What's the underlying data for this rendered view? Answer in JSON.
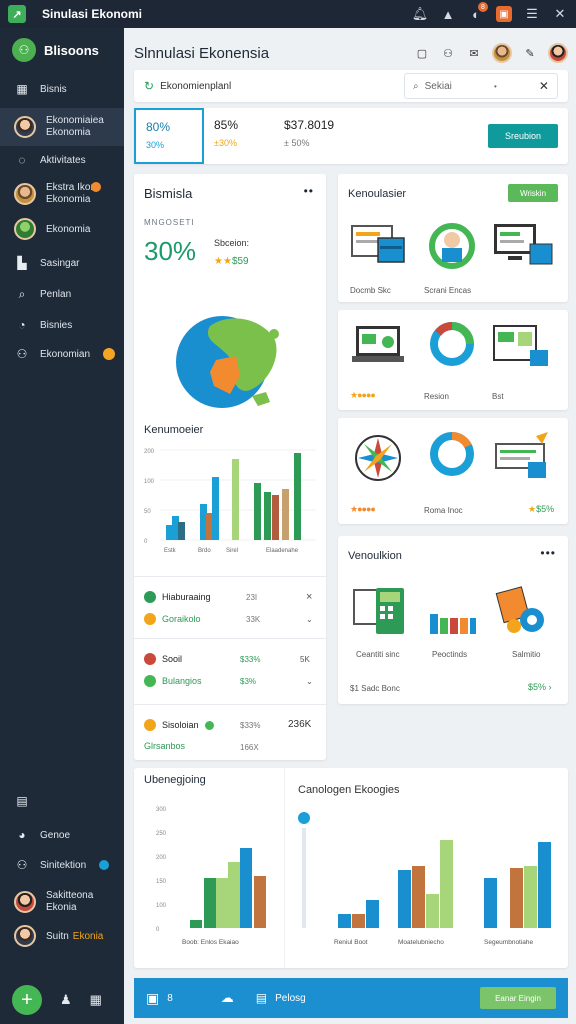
{
  "titlebar": {
    "title": "Sinulasi Ekonomi",
    "logo_glyph": "↗",
    "notif_badge": "8"
  },
  "sidebar": {
    "brand": "Blisoons",
    "items": [
      {
        "label": "Bisnis",
        "icon": "grid-icon"
      },
      {
        "label": "Ekonomiaiea",
        "label2": "Ekonomia",
        "icon": "avatar"
      },
      {
        "label": "Aktivitates",
        "icon": "activity-icon"
      },
      {
        "label": "Ekstra Ikon",
        "label2": "Ekonomia",
        "icon": "avatar"
      },
      {
        "label": "Ekonomia",
        "icon": "avatar"
      },
      {
        "label": "Sasingar",
        "icon": "folder-icon"
      },
      {
        "label": "Penlan",
        "icon": "search-icon"
      },
      {
        "label": "Bisnies",
        "icon": "gauge-icon"
      },
      {
        "label": "Ekonomian",
        "icon": "users-icon"
      }
    ],
    "lower": [
      {
        "label": "Genoe",
        "icon": "person-icon"
      },
      {
        "label": "Sinitektion",
        "icon": "people-icon"
      },
      {
        "label": "Sakitteona",
        "label2": "Ekonia",
        "icon": "avatar"
      },
      {
        "label": "Suitn",
        "label2": "Ekonia",
        "icon": "avatar"
      }
    ]
  },
  "header": {
    "title": "Slnnulasi Ekonensia"
  },
  "search": {
    "label": "Ekonomienplanl",
    "placeholder": "Sekiai"
  },
  "stats": [
    {
      "v1": "80%",
      "v2": "30%",
      "color": "#1a9fd6"
    },
    {
      "v1": "85%",
      "v2": "±30%",
      "color": "#f2a51a"
    },
    {
      "v1": "$37.8019",
      "v2": "± 50%",
      "color": "#777777"
    }
  ],
  "stats_button": "Sreubion",
  "bisnis": {
    "title": "Bismisla",
    "subtitle": "MNGOSETI",
    "big": "30%",
    "mini1": "Sbceion:",
    "mini2_stars": "★★",
    "mini2_value": "$59",
    "chart_title": "Kenumoeier",
    "chart_ylabels": [
      "200",
      "100",
      "50",
      "0"
    ],
    "chart_xlabels": [
      "Estk",
      "Brdo",
      "Sirel",
      "Elaadenahe"
    ],
    "chart_bars": [
      {
        "v": 10,
        "c": "#1a9fd6"
      },
      {
        "v": 16,
        "c": "#1a9fd6"
      },
      {
        "v": 12,
        "c": "#2d6e86"
      },
      {
        "v": 24,
        "c": "#1a9fd6"
      },
      {
        "v": 18,
        "c": "#c1743e"
      },
      {
        "v": 42,
        "c": "#1a9fd6"
      },
      {
        "v": 54,
        "c": "#a6d57a"
      },
      {
        "v": 38,
        "c": "#2d9a55"
      },
      {
        "v": 32,
        "c": "#2d9a55"
      },
      {
        "v": 30,
        "c": "#b25d3f"
      },
      {
        "v": 34,
        "c": "#c7a16d"
      },
      {
        "v": 58,
        "c": "#2d9a55"
      }
    ],
    "rows": [
      {
        "r1": "Hiaburaaing",
        "r2": "Goraikolo",
        "v1": "23I",
        "v2": "33K",
        "close": "×",
        "dot1": "#2d9a55",
        "dot2": "#f2a51a"
      },
      {
        "r1": "Sooil",
        "r2": "Bulangios",
        "v1": "$33%",
        "v2": "$3%",
        "close": "5K",
        "dot1": "#c94a3b",
        "dot2": "#45b654"
      },
      {
        "r1": "Sisoloian",
        "r2": "Glrsanbos",
        "v1": "$33%",
        "v2": "166X",
        "close": "236K",
        "dot1": "#f2a51a",
        "dot2": "#2d9a55"
      }
    ]
  },
  "kenoulasi": {
    "title": "Kenoulasier",
    "button": "Wriskin",
    "labels": [
      "Docmb Skc",
      "Scrani Encas"
    ],
    "row2_labels": [
      "Resion",
      "Bst"
    ],
    "row3_labels": [
      "Roma Inoc",
      "$5%"
    ]
  },
  "venue": {
    "title": "Venoulkion",
    "labels": [
      "Ceantiti sinc",
      "Peoctinds",
      "Salmitio"
    ],
    "footer": "$1 Sadc Bonc",
    "footer_value": "$5%"
  },
  "bottomchart": {
    "title": "Ubenegjoing",
    "title2": "Canologen Ekoogies",
    "ylabels": [
      "300",
      "250",
      "200",
      "150",
      "100",
      "0"
    ],
    "left_x": "Boob: Enlos Ekaiao",
    "right_x1": "Reniul Boot",
    "right_x2": "Moatelubniecho",
    "right_x3": "Segeumbnotiahe"
  },
  "bottombar": {
    "label": "Pelosg",
    "button": "Eanar Eingin"
  }
}
